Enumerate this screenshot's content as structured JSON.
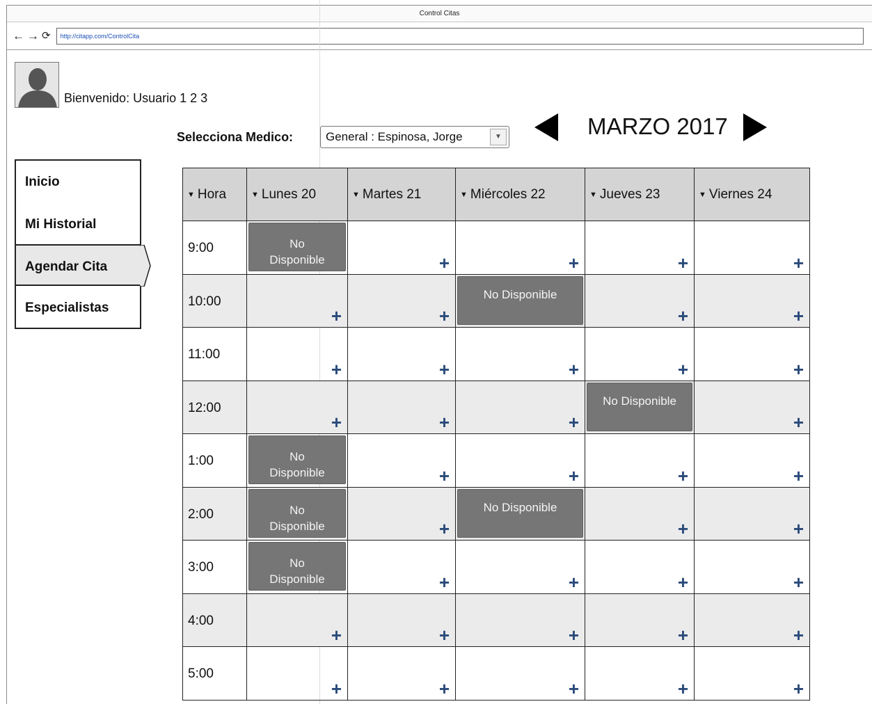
{
  "window": {
    "title": "Control Citas",
    "url": "http://citapp.com/ControlCita"
  },
  "user": {
    "welcome": "Bienvenido: Usuario 1 2 3"
  },
  "selector": {
    "label": "Selecciona Medico:",
    "value": "General : Espinosa, Jorge"
  },
  "calendar": {
    "month": "MARZO 2017"
  },
  "sidebar": {
    "items": [
      {
        "label": "Inicio"
      },
      {
        "label": "Mi Historial"
      },
      {
        "label": "Agendar Cita"
      },
      {
        "label": "Especialistas"
      }
    ],
    "active": "Agendar Cita"
  },
  "schedule": {
    "columns": [
      "Hora",
      "Lunes 20",
      "Martes 21",
      "Miércoles 22",
      "Jueves 23",
      "Viernes 24"
    ],
    "hours": [
      "9:00",
      "10:00",
      "11:00",
      "12:00",
      "1:00",
      "2:00",
      "3:00",
      "4:00",
      "5:00"
    ],
    "unavailable_label_short": "No\nDisponible",
    "unavailable_label_long": "No Disponible",
    "unavailable": [
      {
        "hour": "9:00",
        "day": "Lunes 20"
      },
      {
        "hour": "10:00",
        "day": "Miércoles 22"
      },
      {
        "hour": "12:00",
        "day": "Jueves 23"
      },
      {
        "hour": "1:00",
        "day": "Lunes 20"
      },
      {
        "hour": "2:00",
        "day": "Lunes 20"
      },
      {
        "hour": "2:00",
        "day": "Miércoles 22"
      },
      {
        "hour": "3:00",
        "day": "Lunes 20"
      }
    ],
    "add_symbol": "+"
  },
  "colors": {
    "header_bg": "#d4d4d4",
    "alt_row_bg": "#ebebeb",
    "unavailable_bg": "#767676",
    "plus_color": "#2a4a7a"
  }
}
